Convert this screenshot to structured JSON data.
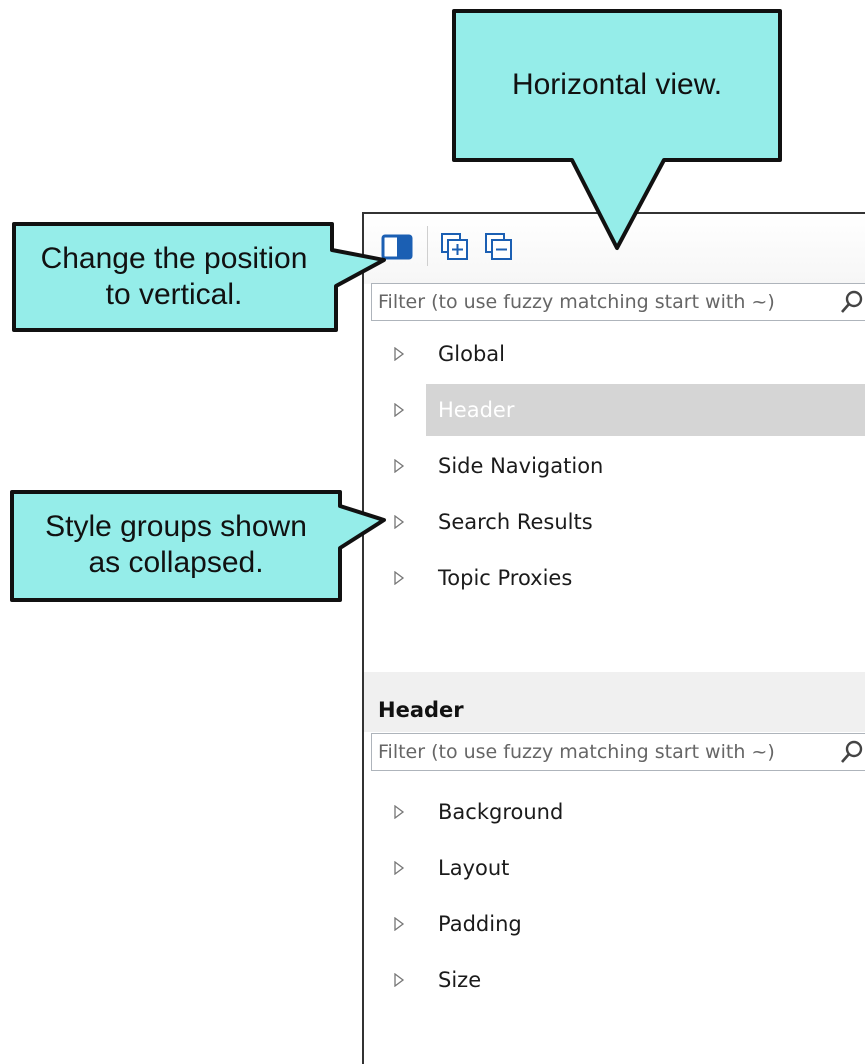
{
  "toolbar": {
    "layout_toggle_icon": "panel-position-icon",
    "expand_all_icon": "expand-all-icon",
    "collapse_all_icon": "collapse-all-icon"
  },
  "top_filter": {
    "placeholder": "Filter (to use fuzzy matching start with ~)",
    "icon": "search-icon"
  },
  "style_groups": [
    {
      "label": "Global",
      "selected": false
    },
    {
      "label": "Header",
      "selected": true
    },
    {
      "label": "Side Navigation",
      "selected": false
    },
    {
      "label": "Search Results",
      "selected": false
    },
    {
      "label": "Topic Proxies",
      "selected": false
    }
  ],
  "properties_section": {
    "title": "Header",
    "filter_placeholder": "Filter (to use fuzzy matching start with ~)",
    "items": [
      {
        "label": "Background"
      },
      {
        "label": "Layout"
      },
      {
        "label": "Padding"
      },
      {
        "label": "Size"
      }
    ]
  },
  "callouts": {
    "horizontal": "Horizontal view.",
    "vertical_line1": "Change the position",
    "vertical_line2": "to vertical.",
    "collapsed_line1": "Style groups shown",
    "collapsed_line2": "as collapsed."
  },
  "colors": {
    "callout_fill": "#95ede9",
    "callout_stroke": "#111111",
    "selected_row": "#d5d5d5",
    "section_bg": "#f0f0f0",
    "accent_icon": "#1b5fb3"
  }
}
